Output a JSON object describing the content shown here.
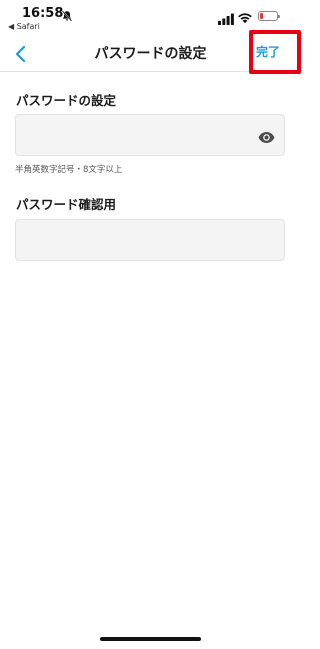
{
  "status_bar": {
    "time": "16:58",
    "back_app": "◀ Safari",
    "battery_level": 0.2,
    "battery_color": "#e53935"
  },
  "nav": {
    "title": "パスワードの設定",
    "done_label": "完了",
    "accent_color": "#1a9be6",
    "highlight_color": "#e60012"
  },
  "form": {
    "password_label": "パスワードの設定",
    "password_value": "",
    "password_hint": "半角英数字記号・8文字以上",
    "confirm_label": "パスワード確認用",
    "confirm_value": ""
  },
  "icons": {
    "back": "chevron-left-icon",
    "visibility": "eye-icon",
    "mute": "bell-slash-icon",
    "signal": "cellular-signal-icon",
    "wifi": "wifi-icon",
    "battery": "battery-icon"
  }
}
